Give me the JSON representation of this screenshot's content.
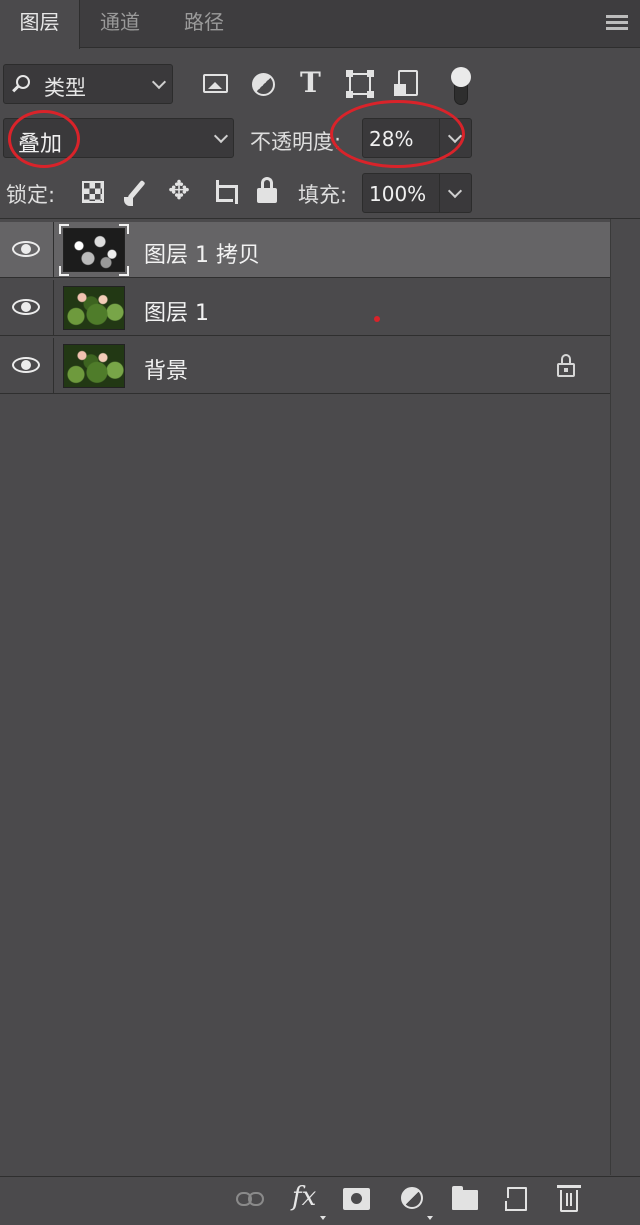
{
  "tabs": [
    {
      "label": "图层",
      "active": true
    },
    {
      "label": "通道",
      "active": false
    },
    {
      "label": "路径",
      "active": false
    }
  ],
  "filter": {
    "kind_label": "类型",
    "icons": [
      "image-filter-icon",
      "adjustment-filter-icon",
      "type-filter-icon",
      "shape-filter-icon",
      "smart-object-filter-icon",
      "filter-toggle"
    ]
  },
  "blend": {
    "mode": "叠加",
    "opacity_label": "不透明度:",
    "opacity_value": "28%"
  },
  "lock": {
    "label": "锁定:",
    "fill_label": "填充:",
    "fill_value": "100%"
  },
  "layers": [
    {
      "name": "图层 1 拷贝",
      "visible": true,
      "selected": true,
      "thumbnail": "grayscale",
      "locked": false
    },
    {
      "name": "图层 1",
      "visible": true,
      "selected": false,
      "thumbnail": "color",
      "locked": false
    },
    {
      "name": "背景",
      "visible": true,
      "selected": false,
      "thumbnail": "color",
      "locked": true
    }
  ],
  "bottom_bar": {
    "fx_label": "fx",
    "icons": [
      "link-layers-icon",
      "layer-style-icon",
      "add-mask-icon",
      "new-adjustment-icon",
      "new-group-icon",
      "new-layer-icon",
      "delete-layer-icon"
    ]
  },
  "colors": {
    "panel": "#4b4a4c",
    "tabbar": "#3e3d3f",
    "selected_row": "#656466",
    "annotation": "#d9232a"
  }
}
